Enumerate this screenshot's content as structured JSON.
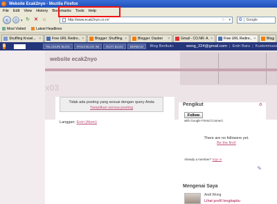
{
  "window": {
    "title": "Website Ecak2nyo - Mozilla Firefox"
  },
  "menu": [
    "File",
    "Edit",
    "View",
    "History",
    "Bookmarks",
    "Tools",
    "Help"
  ],
  "nav": {
    "url": "http://www.ecak2nyo.co.nr/",
    "search_engine": "G",
    "search_placeholder": "Google"
  },
  "bookmarks": [
    "Most Visited",
    "Latest Headlines"
  ],
  "tabs": [
    {
      "label": "Shuffling Knowl...",
      "active": false
    },
    {
      "label": "Free URL Redire...",
      "active": false
    },
    {
      "label": "Blogger: Shuffling...",
      "active": false
    },
    {
      "label": "Blogger: Dasbor",
      "active": false
    },
    {
      "label": "Gmail - CO.NR: A...",
      "active": false
    },
    {
      "label": "Free URL Redire...",
      "active": true
    },
    {
      "label": "Blogger",
      "active": false
    }
  ],
  "blogger_bar": {
    "logo": "B",
    "buttons": [
      "TELUSURI BLOG",
      "PANJI BLOG INI",
      "IKUTI BLOG",
      "BERBAGI"
    ],
    "next_blog": "Blog Berikut»",
    "email": "wong_224@gmail.com",
    "links": [
      "Entri Baru",
      "Kustomisasi"
    ]
  },
  "blog": {
    "title": "website ecak2nyo",
    "header_number": "x03",
    "notice": "Tidak ada posting yang sesuai dengan query Anda",
    "show_all": "Tampilkan semua posting",
    "subscribe_label": "Langgan:",
    "subscribe_link": "Entri (Atom)"
  },
  "sidebar": {
    "followers_title": "Pengikut",
    "follow_button": "Follow",
    "gfc_text": "with Google Friend Connect",
    "no_followers": "There are no followers yet.",
    "be_first": "Be the first!",
    "member_text": "Already a member?",
    "sign_in": "Sign in",
    "about_title": "Mengenai Saya",
    "author": "Andi Wong",
    "profile_link": "Lihat profil lengkapku"
  }
}
